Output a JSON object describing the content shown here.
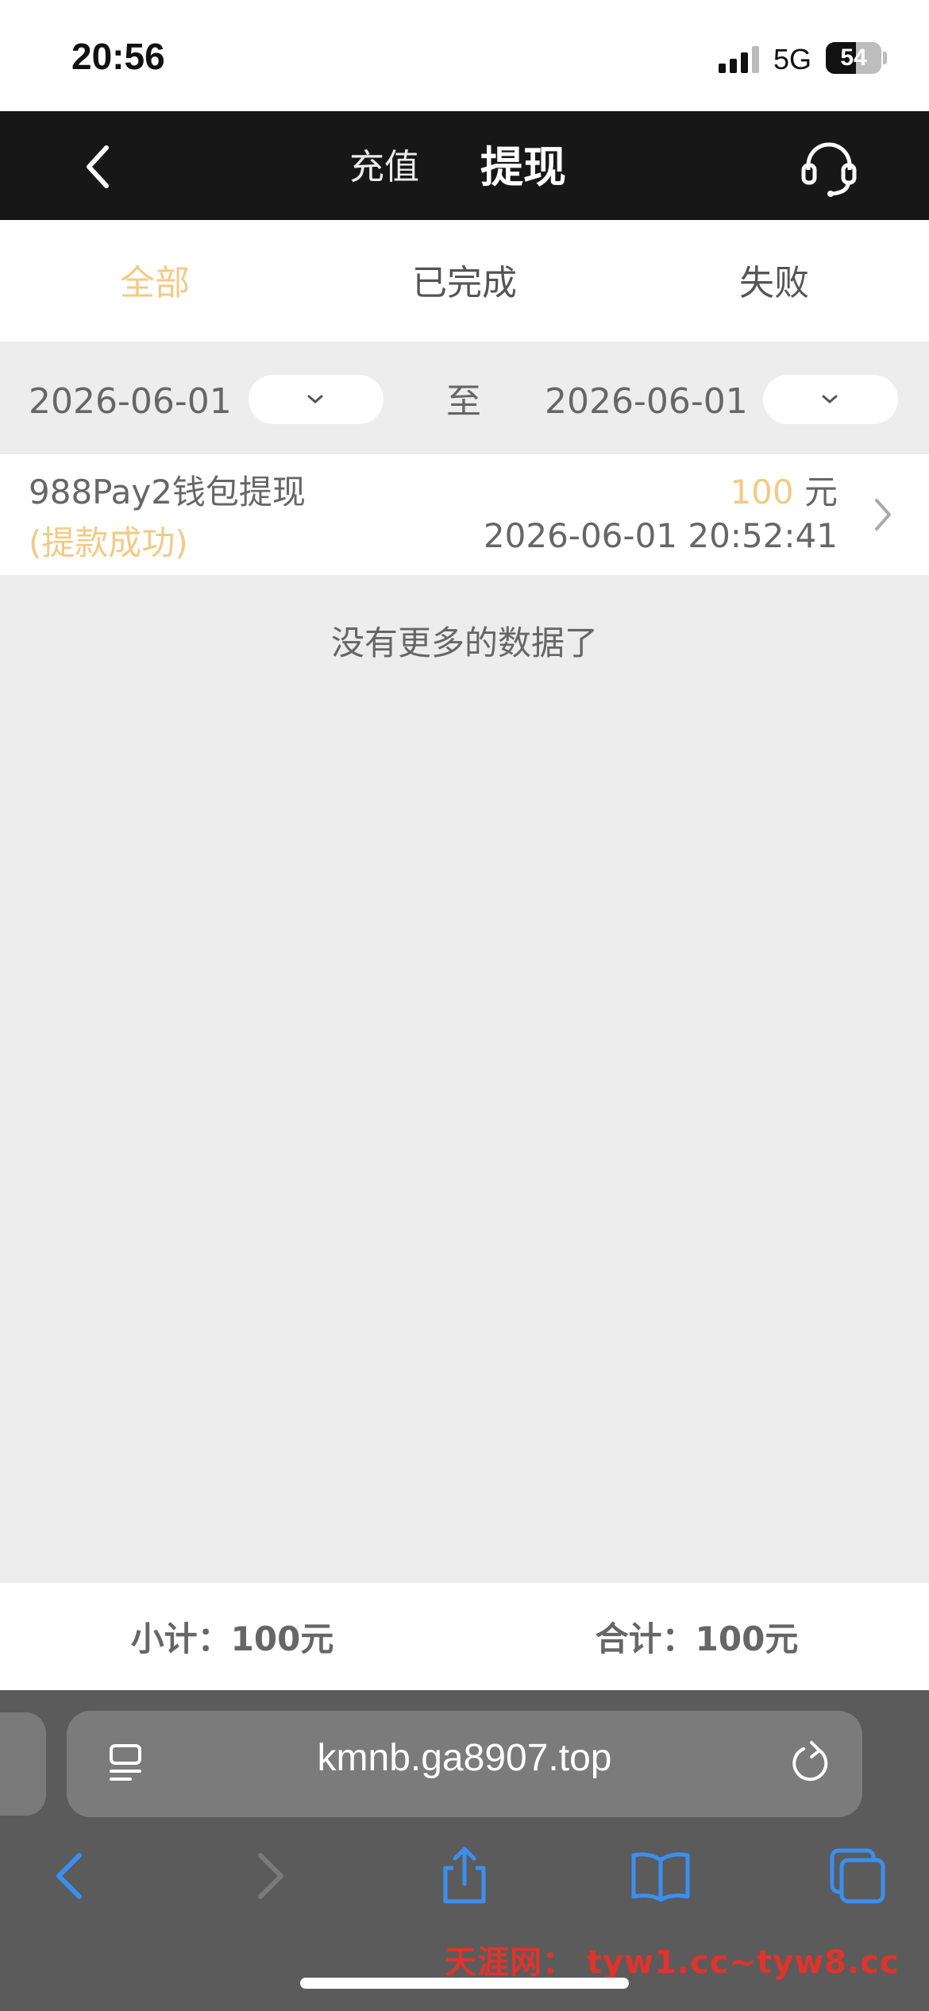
{
  "status_bar": {
    "time": "20:56",
    "network": "5G",
    "battery": "54",
    "battery_level": 0.54
  },
  "header": {
    "tab_recharge": "充值",
    "tab_withdraw": "提现"
  },
  "filter_tabs": [
    "全部",
    "已完成",
    "失败"
  ],
  "date_filter": {
    "start": "2026-06-01",
    "separator": "至",
    "end": "2026-06-01"
  },
  "record": {
    "title": "988Pay2钱包提现",
    "status": "(提款成功)",
    "amount": "100",
    "unit": "元",
    "time": "2026-06-01 20:52:41"
  },
  "no_more": "没有更多的数据了",
  "totals": {
    "subtotal": "小计：100元",
    "total": "合计：100元"
  },
  "browser": {
    "url": "kmnb.ga8907.top"
  },
  "watermark": "天涯网： tyw1.cc~tyw8.cc",
  "colors": {
    "accent": "#f3ca84",
    "header_bg": "#171717",
    "ios_blue": "#3b8ff0"
  }
}
